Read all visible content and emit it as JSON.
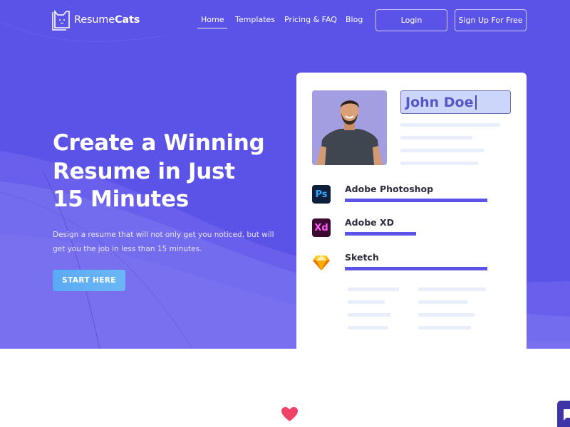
{
  "brand": {
    "logo_icon": "cat-resume-icon",
    "name_regular": "Resume",
    "name_bold": "Cats"
  },
  "nav": {
    "items": [
      {
        "label": "Home",
        "active": true
      },
      {
        "label": "Templates",
        "active": false
      },
      {
        "label": "Pricing & FAQ",
        "active": false
      },
      {
        "label": "Blog",
        "active": false
      }
    ],
    "login_label": "Login",
    "signup_label": "Sign Up For Free"
  },
  "hero": {
    "title_lines": [
      "Create a Winning",
      "Resume in Just",
      "15 Minutes"
    ],
    "subtitle": "Design a resume that will not only get you noticed, but will get you the job in less than 15 minutes.",
    "cta_label": "START HERE"
  },
  "resume_preview": {
    "photo_alt": "smiling man in dark t-shirt",
    "name_value": "John Doe",
    "skills": [
      {
        "name": "Adobe Photoshop",
        "icon": "photoshop-icon",
        "icon_text": "Ps",
        "level": 1.0
      },
      {
        "name": "Adobe XD",
        "icon": "adobe-xd-icon",
        "icon_text": "Xd",
        "level": 0.5
      },
      {
        "name": "Sketch",
        "icon": "sketch-icon",
        "icon_text": "",
        "level": 1.0
      }
    ]
  },
  "colors": {
    "brand_primary": "#5b52e8",
    "cta": "#62aff5",
    "skill_bar": "#5b52e8",
    "heart": "#ee4266",
    "chat": "#3d35a8"
  },
  "footer_icons": {
    "heart": "heart-icon",
    "chat": "chat-icon"
  }
}
